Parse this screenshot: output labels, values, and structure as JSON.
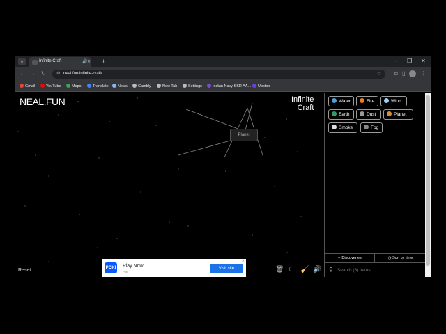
{
  "browser": {
    "tab": {
      "title": "Infinite Craft"
    },
    "new_tab_symbol": "+",
    "window_controls": {
      "minimize": "–",
      "restore": "❐",
      "close": "✕"
    },
    "url": "neal.fun/infinite-craft/",
    "bookmarks": [
      {
        "label": "Gmail",
        "color": "#ea4335"
      },
      {
        "label": "YouTube",
        "color": "#ff0000"
      },
      {
        "label": "Maps",
        "color": "#34a853"
      },
      {
        "label": "Translate",
        "color": "#4285f4"
      },
      {
        "label": "News",
        "color": "#8ab4f8"
      },
      {
        "label": "Cambly",
        "color": "#bbbbbb"
      },
      {
        "label": "New Tab",
        "color": "#bbbbbb"
      },
      {
        "label": "Settings",
        "color": "#bbbbbb"
      },
      {
        "label": "Indian Navy SSR AA...",
        "color": "#7b4bd6"
      },
      {
        "label": "Upstox",
        "color": "#6a3de8"
      }
    ]
  },
  "page": {
    "logo": "NEAL.FUN",
    "brand_line1": "Infinite",
    "brand_line2": "Craft",
    "canvas_item": "Planet",
    "reset_label": "Reset",
    "ad": {
      "logo": "POKI",
      "title": "Play Now",
      "subtitle": "Poki",
      "cta": "Visit site",
      "close": "✕"
    },
    "tools": {
      "trash": "🗑",
      "theme": "☾",
      "clean": "🧹",
      "sound": "🔊"
    }
  },
  "sidebar": {
    "items": [
      {
        "label": "Water",
        "icon": "water-drop-icon",
        "color": "#4aa3df"
      },
      {
        "label": "Fire",
        "icon": "fire-icon",
        "color": "#f27c1c"
      },
      {
        "label": "Wind",
        "icon": "wind-icon",
        "color": "#9ad0f5"
      },
      {
        "label": "Earth",
        "icon": "earth-globe-icon",
        "color": "#2e9c6a"
      },
      {
        "label": "Dust",
        "icon": "dust-icon",
        "color": "#999999"
      },
      {
        "label": "Planet",
        "icon": "planet-icon",
        "color": "#d88a3a"
      },
      {
        "label": "Smoke",
        "icon": "smoke-icon",
        "color": "#dddddd"
      },
      {
        "label": "Fog",
        "icon": "fog-icon",
        "color": "#888888"
      }
    ],
    "sort_discoveries": "Discoveries",
    "sort_time": "Sort by time",
    "search_placeholder": "Search (8) items..."
  }
}
